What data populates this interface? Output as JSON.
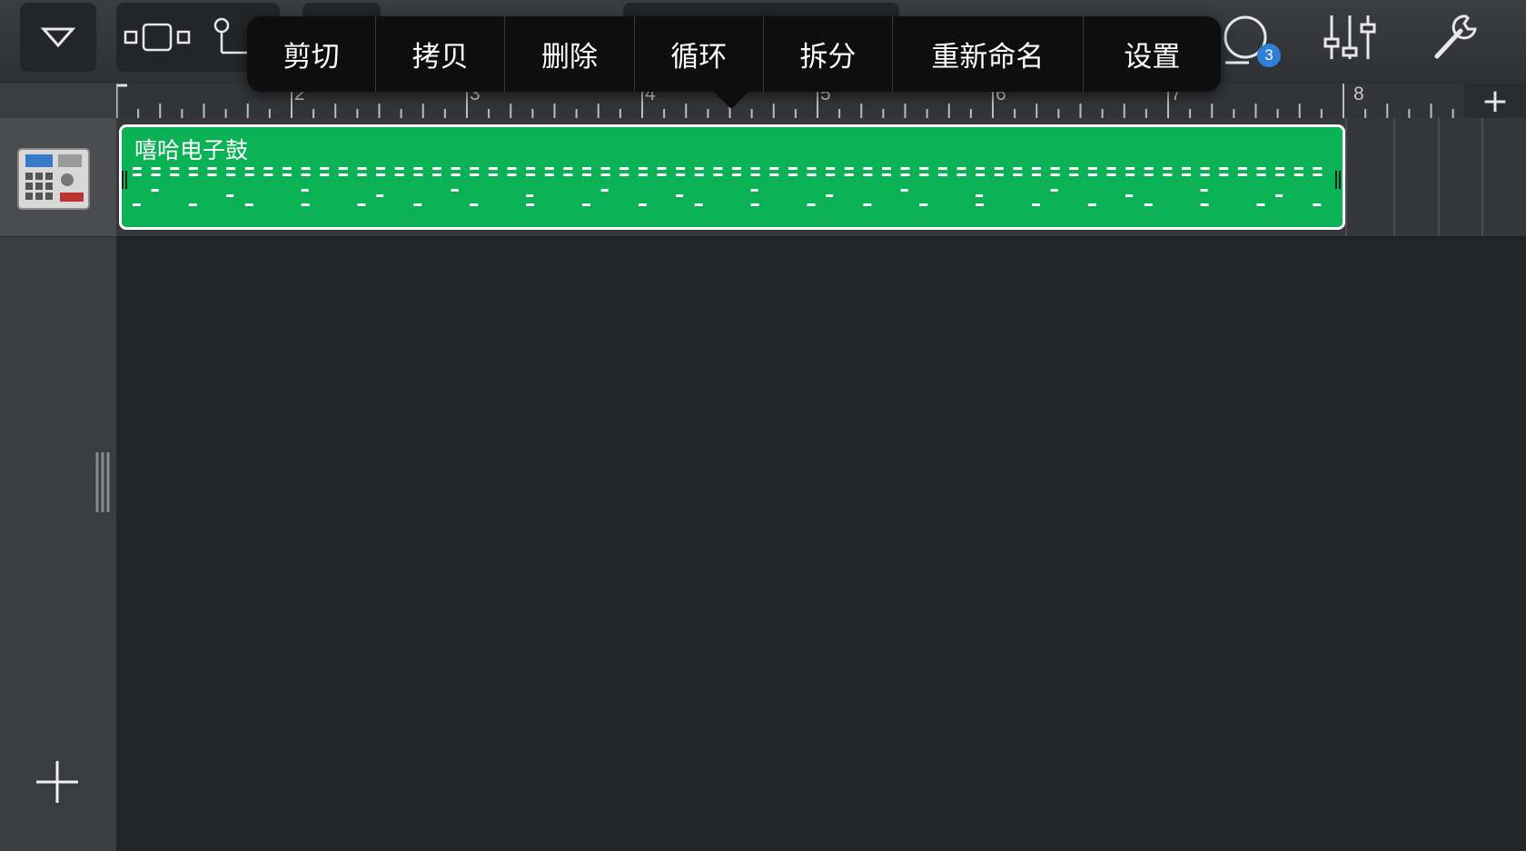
{
  "toolbar": {
    "left_buttons": [
      "dropdown",
      "view-toggle",
      "settings"
    ],
    "loop_badge_count": "3"
  },
  "popup_menu": {
    "items": [
      "剪切",
      "拷贝",
      "删除",
      "循环",
      "拆分",
      "重新命名",
      "设置"
    ]
  },
  "ruler": {
    "numbers": [
      "2",
      "3",
      "4",
      "5",
      "6",
      "7",
      "8"
    ],
    "add_label": "+"
  },
  "track": {
    "instrument": "drum-machine",
    "region_name": "嘻哈电子鼓",
    "region_color": "#0bb155"
  }
}
